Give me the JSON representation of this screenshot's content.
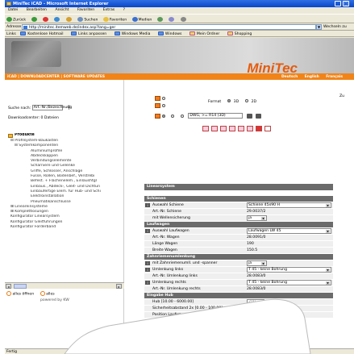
{
  "window": {
    "title": "MiniTec iCAD - Microsoft Internet Explorer",
    "min": "_",
    "max": "□"
  },
  "menu": [
    "Datei",
    "Bearbeiten",
    "Ansicht",
    "Favoriten",
    "Extras",
    "?"
  ],
  "toolbar": {
    "back": "Zurück",
    "search": "Suchen",
    "favorites": "Favoriten",
    "media": "Medien"
  },
  "address": {
    "label": "Adresse",
    "url": "http://minitec.itemweb.de/index.asp?lang=ger",
    "go": "Wechseln zu"
  },
  "links": {
    "label": "Links",
    "items": [
      "Kostenlose Hotmail",
      "Links anpassen",
      "Windows Media",
      "Windows",
      "Mein Ordner",
      "Shopping"
    ]
  },
  "banner": {
    "logo": "MiniTec",
    "nav": "iCAD | DOWNLOADCENTER | SOFTWARE UPDATES",
    "lang": [
      "Deutsch",
      "English",
      "Français"
    ]
  },
  "left": {
    "search_label": "Suche nach:",
    "search_value": "Art.-Nr./Bezeichnung",
    "downloadcenter": "Downloadcenter: 0 Dateien",
    "tree_header": "Produkte",
    "tree": [
      "⊟ Profilsystem-Baukasten",
      "⊟ Systemkomponenten",
      "Aluminiumprofile",
      "Abdeckkappen",
      "Verbindungselemente",
      "Scharniere und Gelenke",
      "Griffe, Schlösser, Anschläge",
      "Füsse, Rollen, Bodenbef., Verstrebi",
      "Befest. + Flächenelem., Einlaushtgl",
      "Einbaus., Abdeck-, Gleit- und Dichtun",
      "Einbaufertige Elem. für Hub- und Schi",
      "Elektroinstallation",
      "Pneumatikanschlüsse",
      "⊞ Lineareinsysteme",
      "⊞ Komplettlösungen",
      "Konfigurator Linearsystem",
      "Konfigurator Gleitführungen",
      "Konfigurator Förderband"
    ],
    "footer_buttons": [
      "alles öffnen",
      "alles"
    ],
    "powered_by": "powered by KW"
  },
  "tool": {
    "format_label": "Format",
    "format_options": [
      "3D",
      "2D"
    ],
    "dwg_value": "DWG, >= R14 (3D)"
  },
  "form": {
    "title": "Linearsystem",
    "sections": [
      {
        "header": "Schienen",
        "rows": [
          {
            "label": "Auswahl Schiene",
            "type": "select",
            "value": "Schiene 45x90 H",
            "info": true
          },
          {
            "label": "Art.-Nr. Schiene",
            "type": "text",
            "value": "29.0037/2"
          },
          {
            "label": "mit Wellensicherung",
            "type": "select_short",
            "value": "ja"
          }
        ]
      },
      {
        "header": "Laufwagen",
        "rows": [
          {
            "label": "Auswahl Laufwagen",
            "type": "select",
            "value": "Laufwagen LW 45",
            "info": true
          },
          {
            "label": "Art.-Nr. Wagen",
            "type": "text",
            "value": "28.0091/0"
          },
          {
            "label": "Länge Wagen",
            "type": "text",
            "value": "190"
          },
          {
            "label": "Breite Wagen",
            "type": "text",
            "value": "150.5"
          }
        ]
      },
      {
        "header": "Zahnriemenumlenkung",
        "rows": [
          {
            "label": "mit Zahnriemenumll. und -spanner",
            "type": "select_short",
            "value": "ja",
            "info": true
          },
          {
            "label": "Umlenkung links",
            "type": "select",
            "value": "T 45 - keine Bohrung",
            "info": true
          },
          {
            "label": "Art.-Nr. Umlenkung links",
            "type": "text",
            "value": "28.0083/0"
          },
          {
            "label": "Umlenkung rechts",
            "type": "select",
            "value": "T 45 - keine Bohrung",
            "info": true
          },
          {
            "label": "Art.-Nr. Umlenkung rechts",
            "type": "text",
            "value": "28.0083/0"
          }
        ]
      },
      {
        "header": "Eingabe Hub",
        "rows": [
          {
            "label": "Hub [10.00 - 6000.00]",
            "type": "input",
            "value": "200"
          },
          {
            "label": "Sicherheitsabstand 2x [0.00 - 100.00]",
            "type": "input",
            "value": "20"
          },
          {
            "label": "Position Laufwagen [0.00 - 200.00]",
            "type": "input",
            "value": "100"
          }
        ]
      }
    ]
  },
  "status": {
    "left": "Fertig",
    "right": "Internet"
  },
  "side_label": "Zu"
}
